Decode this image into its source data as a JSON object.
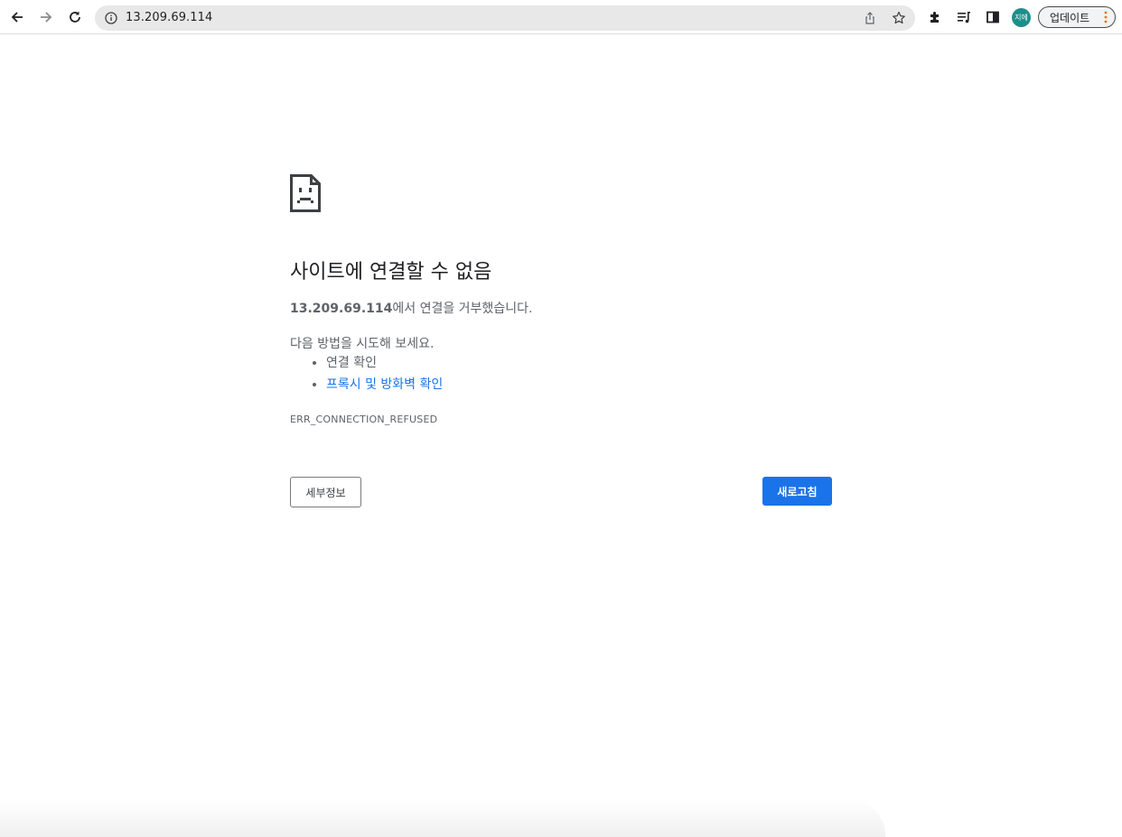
{
  "browser": {
    "url": "13.209.69.114",
    "profile_initials": "지에",
    "update_label": "업데이트",
    "accent_color": "#1a73e8",
    "icons": [
      "back-arrow-icon",
      "forward-arrow-icon",
      "reload-icon",
      "info-icon",
      "share-icon",
      "star-icon",
      "extensions-puzzle-icon",
      "media-queue-icon",
      "side-panel-icon",
      "kebab-menu-icon"
    ]
  },
  "error_page": {
    "icon": "sad-page-icon",
    "heading": "사이트에 연결할 수 없음",
    "host": "13.209.69.114",
    "summary_suffix": "에서 연결을 거부했습니다.",
    "suggestions_title": "다음 방법을 시도해 보세요.",
    "suggestions": [
      {
        "text": "연결 확인",
        "is_link": false
      },
      {
        "text": "프록시 및 방화벽 확인",
        "is_link": true
      }
    ],
    "error_code": "ERR_CONNECTION_REFUSED",
    "details_button": "세부정보",
    "reload_button": "새로고침"
  }
}
